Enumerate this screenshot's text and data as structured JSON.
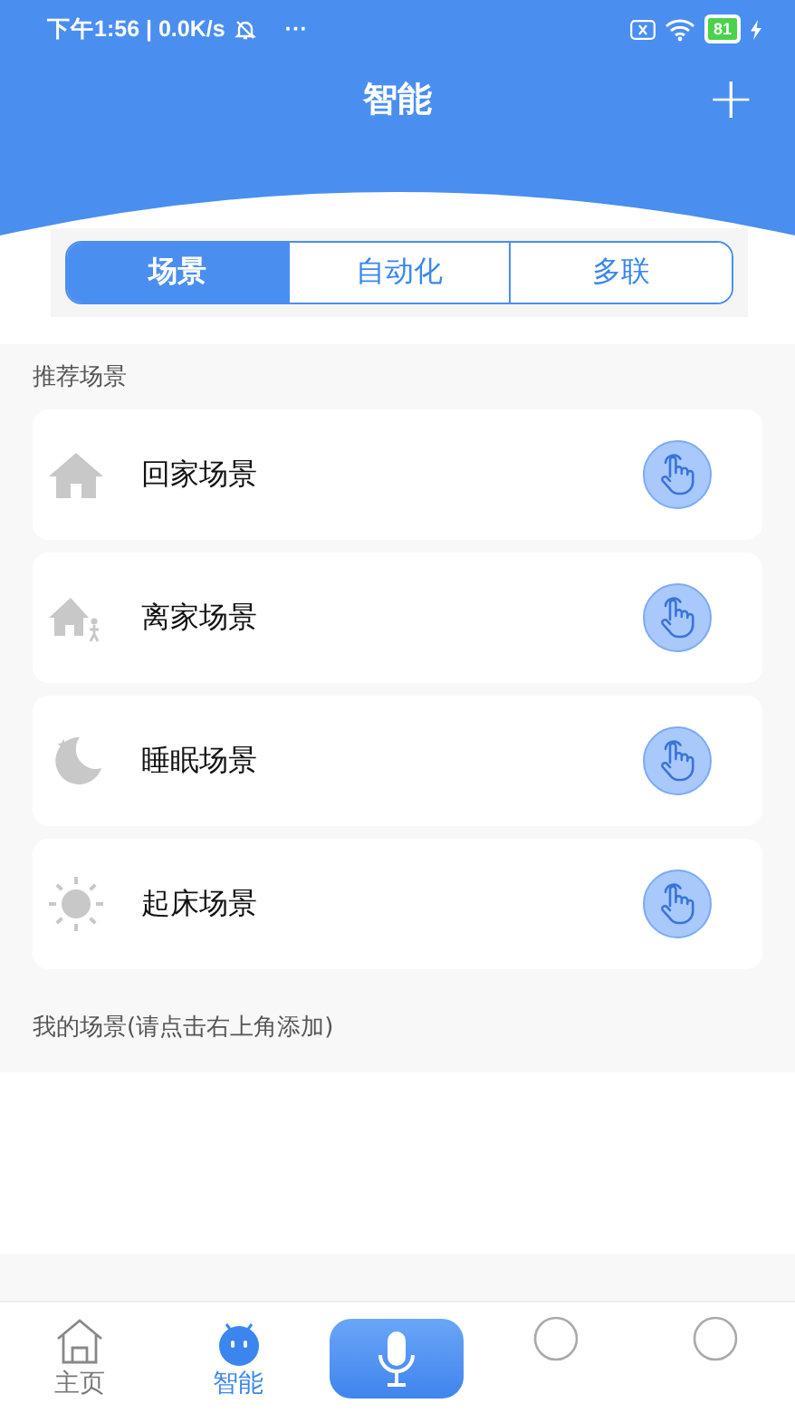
{
  "status_bar": {
    "time": "下午1:56 | 0.0K/s",
    "more": "···",
    "battery": "81",
    "charging": true
  },
  "header": {
    "title": "智能",
    "add": "+"
  },
  "tabs": [
    {
      "label": "场景",
      "selected": true
    },
    {
      "label": "自动化",
      "selected": false
    },
    {
      "label": "多联",
      "selected": false
    }
  ],
  "recommended": {
    "heading": "推荐场景",
    "scenes": [
      {
        "kind": "home",
        "name": "回家场景"
      },
      {
        "kind": "leave",
        "name": "离家场景"
      },
      {
        "kind": "sleep",
        "name": "睡眠场景"
      },
      {
        "kind": "wake",
        "name": "起床场景"
      }
    ]
  },
  "my_scenes": {
    "heading": "我的场景(请点击右上角添加)"
  },
  "bottom_nav": [
    {
      "kind": "home",
      "label": "主页",
      "selected": false
    },
    {
      "kind": "robot",
      "label": "智能",
      "selected": true
    },
    {
      "kind": "mic"
    },
    {
      "kind": "hidden"
    },
    {
      "kind": "hidden"
    }
  ]
}
